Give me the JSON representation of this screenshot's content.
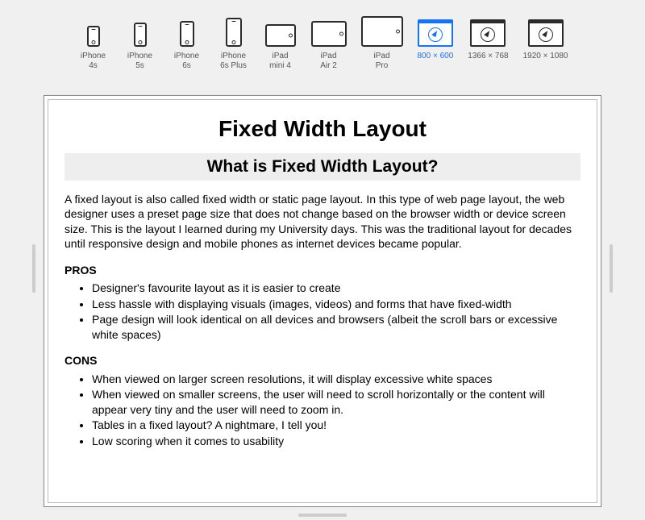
{
  "devices": [
    {
      "id": "iphone-4s",
      "label": "iPhone\n4s",
      "interactable": true
    },
    {
      "id": "iphone-5s",
      "label": "iPhone\n5s",
      "interactable": true
    },
    {
      "id": "iphone-6s",
      "label": "iPhone\n6s",
      "interactable": true
    },
    {
      "id": "iphone-6sp",
      "label": "iPhone\n6s Plus",
      "interactable": true
    },
    {
      "id": "ipad-mini4",
      "label": "iPad\nmini 4",
      "interactable": true
    },
    {
      "id": "ipad-air2",
      "label": "iPad\nAir 2",
      "interactable": true
    },
    {
      "id": "ipad-pro",
      "label": "iPad\nPro",
      "interactable": true
    },
    {
      "id": "res-800",
      "label": "800 × 600",
      "interactable": true,
      "selected": true
    },
    {
      "id": "res-1366",
      "label": "1366 × 768",
      "interactable": true
    },
    {
      "id": "res-1920",
      "label": "1920 × 1080",
      "interactable": true
    }
  ],
  "doc": {
    "title": "Fixed Width Layout",
    "subtitle": "What is Fixed Width Layout?",
    "intro": "A fixed layout is also called fixed width or static page layout. In this type of web page layout, the web designer uses a preset page size that does not change based on the browser width or device screen size. This is the layout I learned during my University days. This was the traditional layout for decades until responsive design and mobile phones as internet devices became popular.",
    "pros_label": "PROS",
    "pros": [
      "Designer's favourite layout as it is easier to create",
      "Less hassle with displaying visuals (images, videos) and forms that have fixed-width",
      "Page design will look identical on all devices and browsers (albeit the scroll bars or excessive white spaces)"
    ],
    "cons_label": "CONS",
    "cons": [
      "When viewed on larger screen resolutions, it will display excessive white spaces",
      "When viewed on smaller screens, the user will need to scroll horizontally or the content will appear very tiny and the user will need to zoom in.",
      "Tables in a fixed layout? A nightmare, I tell you!",
      "Low scoring when it comes to usability"
    ]
  }
}
